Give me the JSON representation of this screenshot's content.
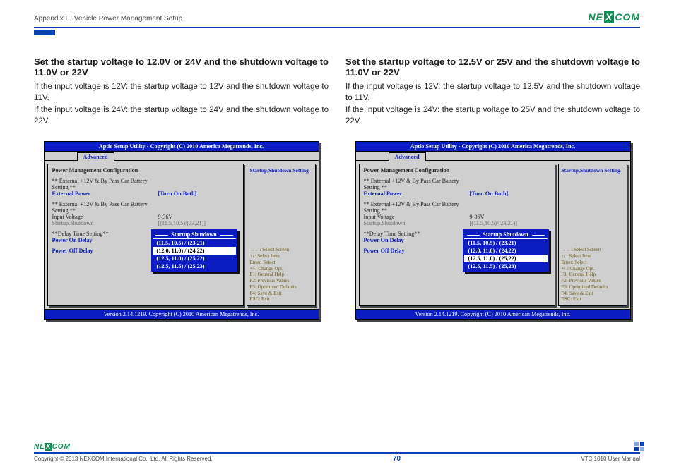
{
  "header": {
    "appendix": "Appendix E: Vehicle Power Management Setup",
    "logo_ne": "NE",
    "logo_x": "X",
    "logo_com": "COM"
  },
  "left": {
    "title": "Set the startup voltage to 12.0V or 24V and the shutdown voltage to 11.0V or 22V",
    "p1": "If the input voltage is 12V: the startup voltage to 12V and the shutdown voltage to 11V.",
    "p2": "If the input voltage is 24V: the startup voltage to 24V and the shutdown voltage to 22V.",
    "popup_selected_index": 1
  },
  "right": {
    "title": "Set the startup voltage to 12.5V or 25V and the shutdown voltage to 11.0V or 22V",
    "p1": "If the input voltage is 12V: the startup voltage to 12.5V and the shutdown voltage to 11V.",
    "p2": "If the input voltage is 24V: the startup voltage to 25V and the shutdown voltage to 22V.",
    "popup_selected_index": 2
  },
  "bios": {
    "titlebar": "Aptio Setup Utility - Copyright (C) 2010 America Megatrends, Inc.",
    "tab": "Advanced",
    "pm_title": "Power Management Configuration",
    "ext_heading": "** External +12V & By Pass Car Battery Setting **",
    "external_power_k": "External Power",
    "external_power_v": "[Turn On Both]",
    "input_voltage_k": "Input Voltage",
    "input_voltage_v": "9-36V",
    "startup_shutdown_k": "Startup.Shutdown",
    "startup_shutdown_v": "[(11.5,10.5)/(23,21)]",
    "delay_heading": "**Delay Time Setting**",
    "power_on_delay": "Power On Delay",
    "power_off_delay": "Power Off Delay",
    "popup_title": "Startup.Shutdown",
    "popup_options": [
      "(11.5, 10.5) / (23,21)",
      "(12.0, 11.0) / (24,22)",
      "(12.5, 11.0) / (25,22)",
      "(12.5, 11.5) / (25,23)"
    ],
    "right_title": "Startup,Shutdown Setting",
    "help": [
      "→←: Select Screen",
      "↑↓: Select Item",
      "Enter: Select",
      "+/-: Change Opt.",
      "F1: General Help",
      "F2: Previous Values",
      "F3: Optimized Defaults",
      "F4: Save & Exit",
      "ESC: Exit"
    ],
    "footer": "Version 2.14.1219. Copyright (C) 2010 American Megatrends, Inc."
  },
  "footer": {
    "copyright": "Copyright © 2013 NEXCOM International Co., Ltd. All Rights Reserved.",
    "page": "70",
    "manual": "VTC 1010 User Manual"
  }
}
